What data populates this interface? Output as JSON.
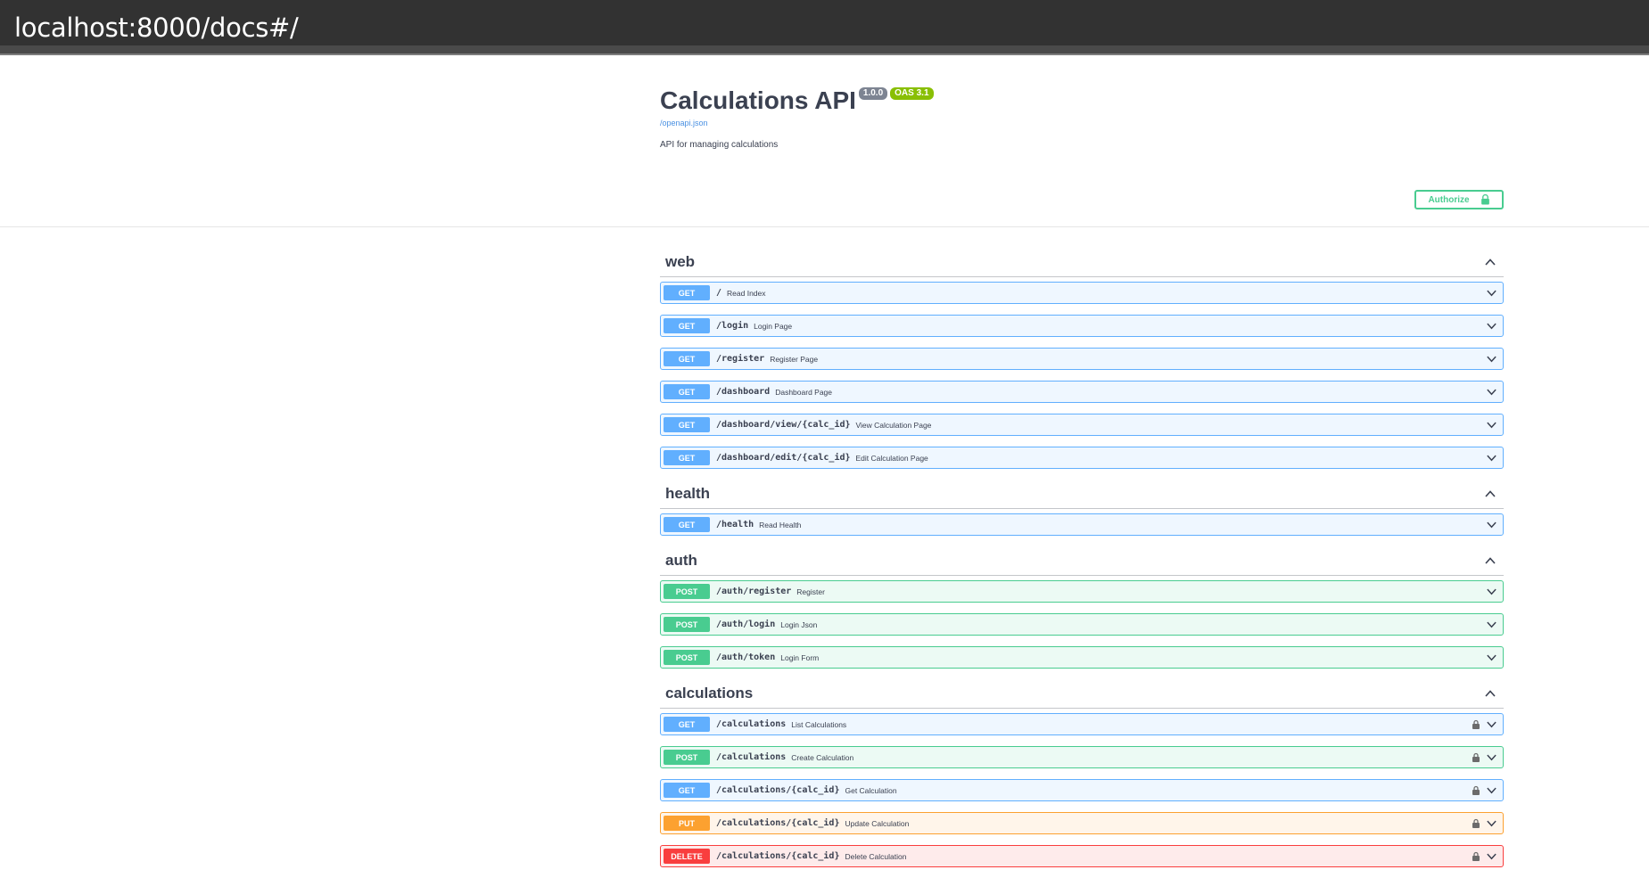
{
  "browser": {
    "url": "localhost:8000/docs#/"
  },
  "info": {
    "title": "Calculations API",
    "version": "1.0.0",
    "oas": "OAS 3.1",
    "spec_link": "/openapi.json",
    "description": "API for managing calculations"
  },
  "authorize": {
    "label": "Authorize"
  },
  "colors": {
    "get": "#61affe",
    "post": "#49cc90",
    "put": "#fca130",
    "delete": "#f93e3e"
  },
  "tags": [
    {
      "name": "web",
      "operations": [
        {
          "method": "GET",
          "path": "/",
          "summary": "Read Index",
          "locked": false
        },
        {
          "method": "GET",
          "path": "/login",
          "summary": "Login Page",
          "locked": false
        },
        {
          "method": "GET",
          "path": "/register",
          "summary": "Register Page",
          "locked": false
        },
        {
          "method": "GET",
          "path": "/dashboard",
          "summary": "Dashboard Page",
          "locked": false
        },
        {
          "method": "GET",
          "path": "/dashboard/view/{calc_id}",
          "summary": "View Calculation Page",
          "locked": false
        },
        {
          "method": "GET",
          "path": "/dashboard/edit/{calc_id}",
          "summary": "Edit Calculation Page",
          "locked": false
        }
      ]
    },
    {
      "name": "health",
      "operations": [
        {
          "method": "GET",
          "path": "/health",
          "summary": "Read Health",
          "locked": false
        }
      ]
    },
    {
      "name": "auth",
      "operations": [
        {
          "method": "POST",
          "path": "/auth/register",
          "summary": "Register",
          "locked": false
        },
        {
          "method": "POST",
          "path": "/auth/login",
          "summary": "Login Json",
          "locked": false
        },
        {
          "method": "POST",
          "path": "/auth/token",
          "summary": "Login Form",
          "locked": false
        }
      ]
    },
    {
      "name": "calculations",
      "operations": [
        {
          "method": "GET",
          "path": "/calculations",
          "summary": "List Calculations",
          "locked": true
        },
        {
          "method": "POST",
          "path": "/calculations",
          "summary": "Create Calculation",
          "locked": true
        },
        {
          "method": "GET",
          "path": "/calculations/{calc_id}",
          "summary": "Get Calculation",
          "locked": true
        },
        {
          "method": "PUT",
          "path": "/calculations/{calc_id}",
          "summary": "Update Calculation",
          "locked": true
        },
        {
          "method": "DELETE",
          "path": "/calculations/{calc_id}",
          "summary": "Delete Calculation",
          "locked": true
        }
      ]
    }
  ]
}
